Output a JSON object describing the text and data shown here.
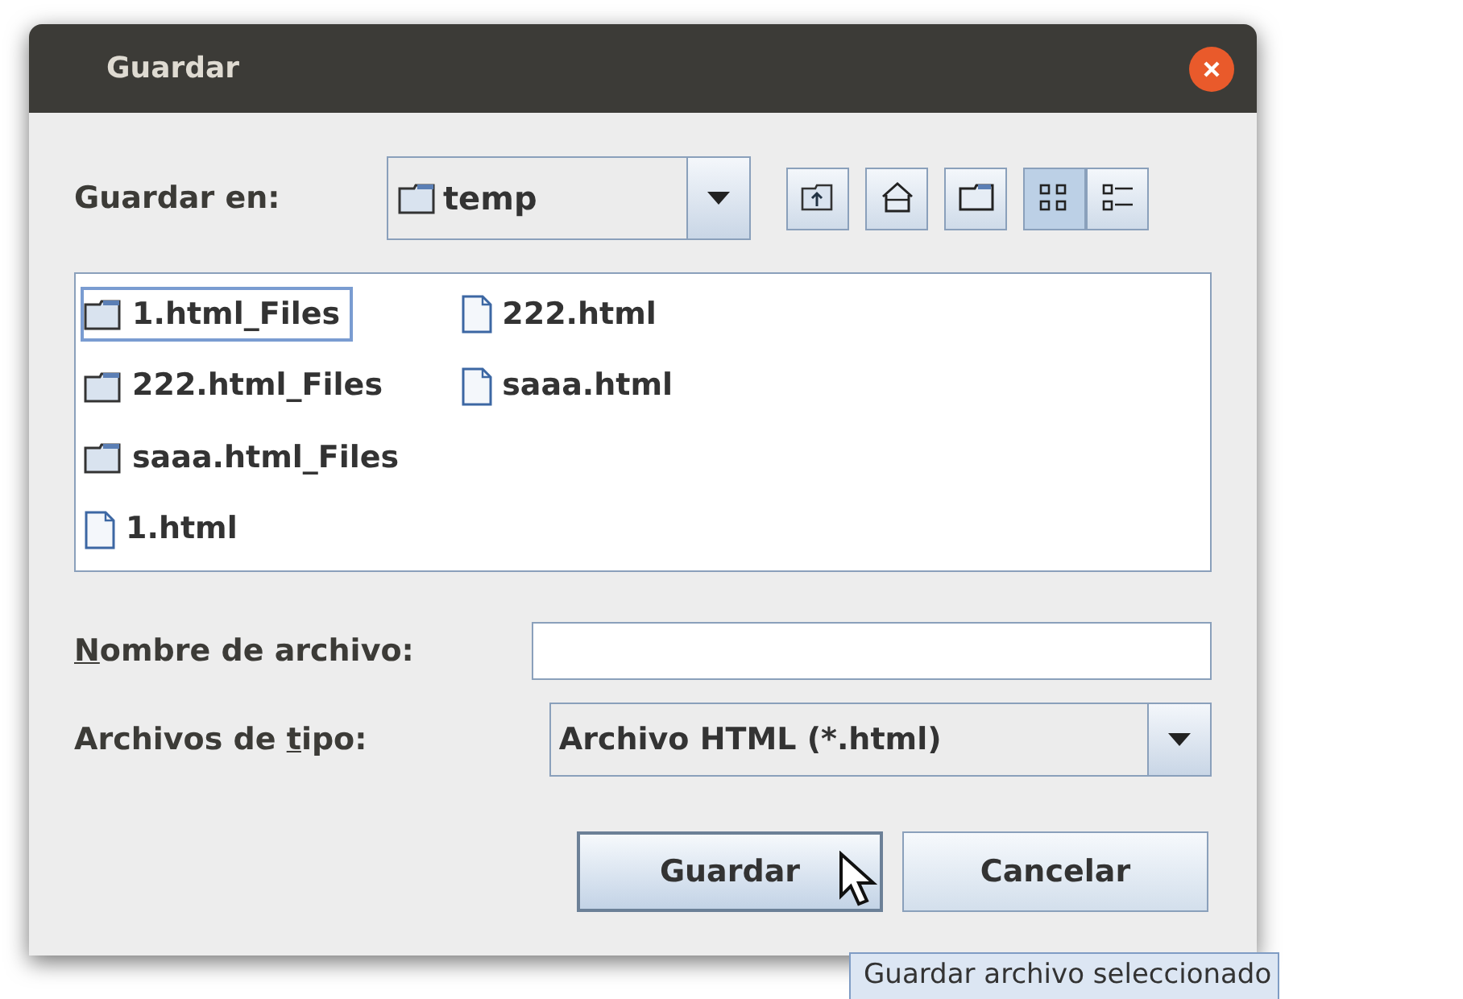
{
  "window": {
    "title": "Guardar"
  },
  "look_in": {
    "label": "Guardar en:",
    "value": "temp"
  },
  "toolbar": [
    {
      "kind": "up",
      "selected": false
    },
    {
      "kind": "home",
      "selected": false
    },
    {
      "kind": "newfolder",
      "selected": false
    },
    {
      "kind": "list",
      "selected": true
    },
    {
      "kind": "details",
      "selected": false
    }
  ],
  "files": [
    {
      "name": "1.html_Files",
      "kind": "folder",
      "selected": true
    },
    {
      "name": "222.html_Files",
      "kind": "folder",
      "selected": false
    },
    {
      "name": "saaa.html_Files",
      "kind": "folder",
      "selected": false
    },
    {
      "name": "1.html",
      "kind": "file",
      "selected": false
    },
    {
      "name": "222.html",
      "kind": "file",
      "selected": false
    },
    {
      "name": "saaa.html",
      "kind": "file",
      "selected": false
    }
  ],
  "filename": {
    "mnemonic": "N",
    "label_after": "ombre de archivo:"
  },
  "filetype": {
    "label_before": "Archivos de ",
    "mnemonic": "t",
    "label_after": "ipo:",
    "value": "Archivo HTML (*.html)"
  },
  "buttons": [
    {
      "label": "Guardar",
      "hovered": true
    },
    {
      "label": "Cancelar",
      "hovered": false
    }
  ],
  "tooltip": "Guardar archivo seleccionado"
}
